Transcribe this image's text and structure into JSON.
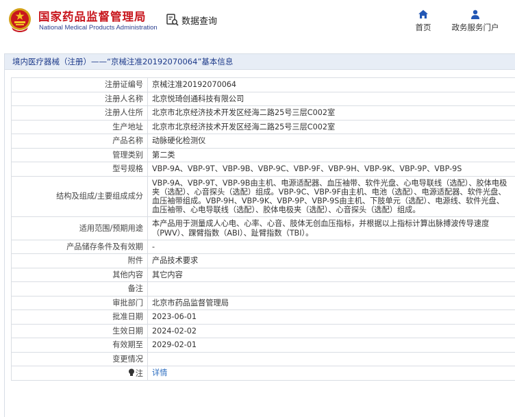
{
  "header": {
    "brand_cn": "国家药品监督管理局",
    "brand_en": "National Medical Products Administration",
    "query_label": "数据查询",
    "nav": [
      {
        "label": "首页",
        "icon": "home-icon"
      },
      {
        "label": "政务服务门户",
        "icon": "user-icon"
      }
    ]
  },
  "panel": {
    "title": "境内医疗器械（注册）——“京械注准20192070064”基本信息"
  },
  "rows": [
    {
      "label": "注册证编号",
      "value": "京械注准20192070064"
    },
    {
      "label": "注册人名称",
      "value": "北京悦琦创通科技有限公司"
    },
    {
      "label": "注册人住所",
      "value": "北京市北京经济技术开发区经海二路25号三层C002室"
    },
    {
      "label": "生产地址",
      "value": "北京市北京经济技术开发区经海二路25号三层C002室"
    },
    {
      "label": "产品名称",
      "value": "动脉硬化检测仪"
    },
    {
      "label": "管理类别",
      "value": "第二类"
    },
    {
      "label": "型号规格",
      "value": "VBP-9A、VBP-9T、VBP-9B、VBP-9C、VBP-9F、VBP-9H、VBP-9K、VBP-9P、VBP-9S"
    },
    {
      "label": "结构及组成/主要组成成分",
      "value": "VBP-9A、VBP-9T、VBP-9B由主机、电源适配器、血压袖带、软件光盘、心电导联线（选配）、胶体电极夹（选配）、心音探头（选配）组成。VBP-9C、VBP-9F由主机、电池（选配）、电源适配器、软件光盘、血压袖带组成。VBP-9H、VBP-9K、VBP-9P、VBP-9S由主机、下肢单元（选配）、电源线、软件光盘、血压袖带、心电导联线（选配）、胶体电极夹（选配）、心音探头（选配）组成。"
    },
    {
      "label": "适用范围/预期用途",
      "value": "本产品用于测量成人心电、心率、心音、肢体无创血压指标，并根据以上指标计算出脉搏波传导速度（PWV）、踝臂指数（ABI）、趾臂指数（TBI）。"
    },
    {
      "label": "产品储存条件及有效期",
      "value": "-"
    },
    {
      "label": "附件",
      "value": "产品技术要求"
    },
    {
      "label": "其他内容",
      "value": "其它内容"
    },
    {
      "label": "备注",
      "value": ""
    },
    {
      "label": "审批部门",
      "value": "北京市药品监督管理局"
    },
    {
      "label": "批准日期",
      "value": "2023-06-01"
    },
    {
      "label": "生效日期",
      "value": "2024-02-02"
    },
    {
      "label": "有效期至",
      "value": "2029-02-01"
    },
    {
      "label": "变更情况",
      "value": ""
    },
    {
      "label": "注",
      "value": "详情",
      "icon": "lightbulb-icon"
    }
  ],
  "colors": {
    "brand_red": "#c8161d",
    "brand_blue": "#2a3f8f",
    "title_blue": "#1d3a8a",
    "link_blue": "#2d6ec0",
    "title_bar": "#e7edf6"
  }
}
